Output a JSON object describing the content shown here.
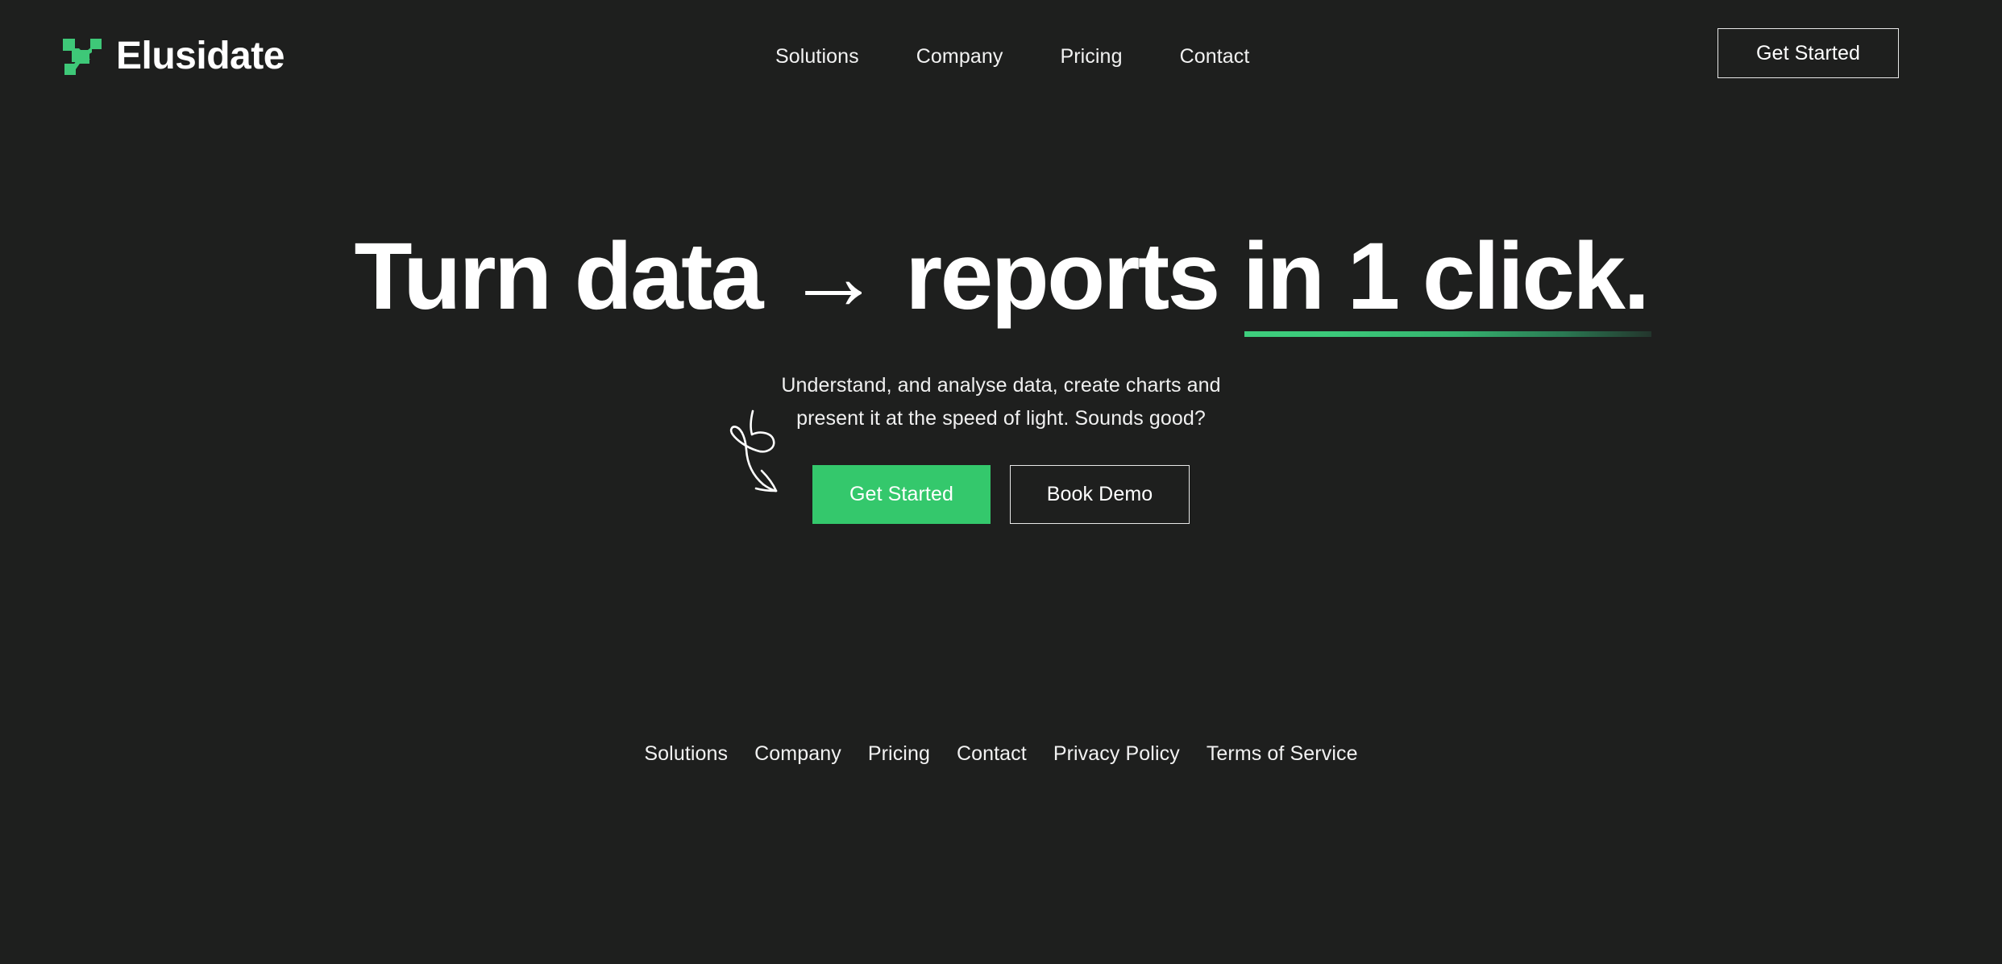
{
  "theme": {
    "background": "#1e1f1e",
    "accent_green": "#34c86c",
    "logo_green": "#3ec878",
    "text": "#ffffff",
    "border": "#e8e8e8"
  },
  "header": {
    "logo_icon": "elusidate-node-mark-icon",
    "brand_name": "Elusidate",
    "nav": [
      {
        "label": "Solutions"
      },
      {
        "label": "Company"
      },
      {
        "label": "Pricing"
      },
      {
        "label": "Contact"
      }
    ],
    "cta_label": "Get Started"
  },
  "hero": {
    "headline": {
      "part1": "Turn data ",
      "arrow": "→",
      "part2": " reports ",
      "accent": "in 1 click."
    },
    "subtitle_line1": "Understand, and analyse data, create charts and",
    "subtitle_line2": "present it at the speed of light. Sounds good?",
    "primary_cta": "Get Started",
    "secondary_cta": "Book Demo",
    "doodle_icon": "hand-drawn-looping-arrow-icon"
  },
  "footer": {
    "links": [
      {
        "label": "Solutions"
      },
      {
        "label": "Company"
      },
      {
        "label": "Pricing"
      },
      {
        "label": "Contact"
      },
      {
        "label": "Privacy Policy"
      },
      {
        "label": "Terms of Service"
      }
    ]
  }
}
